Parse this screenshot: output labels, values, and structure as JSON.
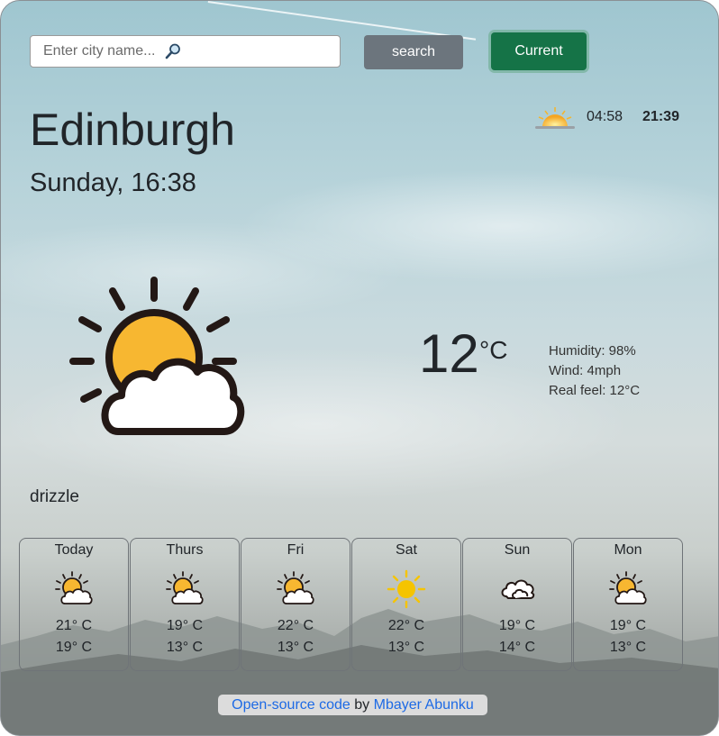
{
  "search": {
    "placeholder": "Enter city name...",
    "button_label": "search",
    "current_label": "Current"
  },
  "location": {
    "city": "Edinburgh",
    "datetime": "Sunday, 16:38"
  },
  "sun": {
    "sunrise": "04:58",
    "sunset": "21:39",
    "icon": "sunrise-icon"
  },
  "current": {
    "icon": "partly-cloudy-icon",
    "temperature": "12",
    "unit": "°C",
    "humidity": "Humidity: 98%",
    "wind": "Wind: 4mph",
    "real_feel": "Real feel: 12°C",
    "description": "drizzle"
  },
  "forecast": [
    {
      "day": "Today",
      "icon": "partly-cloudy-icon",
      "high": "21° C",
      "low": "19° C"
    },
    {
      "day": "Thurs",
      "icon": "partly-cloudy-icon",
      "high": "19° C",
      "low": "13° C"
    },
    {
      "day": "Fri",
      "icon": "partly-cloudy-icon",
      "high": "22° C",
      "low": "13° C"
    },
    {
      "day": "Sat",
      "icon": "sun-icon",
      "high": "22° C",
      "low": "13° C"
    },
    {
      "day": "Sun",
      "icon": "cloud-icon",
      "high": "19° C",
      "low": "14° C"
    },
    {
      "day": "Mon",
      "icon": "partly-cloudy-icon",
      "high": "19° C",
      "low": "13° C"
    }
  ],
  "footer": {
    "code_link": "Open-source code",
    "by": "by",
    "author_link": "Mbayer Abunku"
  },
  "colors": {
    "current_button": "#157347",
    "search_button": "#6c757d",
    "link": "#1d6ae5",
    "sun": "#f7b731"
  }
}
